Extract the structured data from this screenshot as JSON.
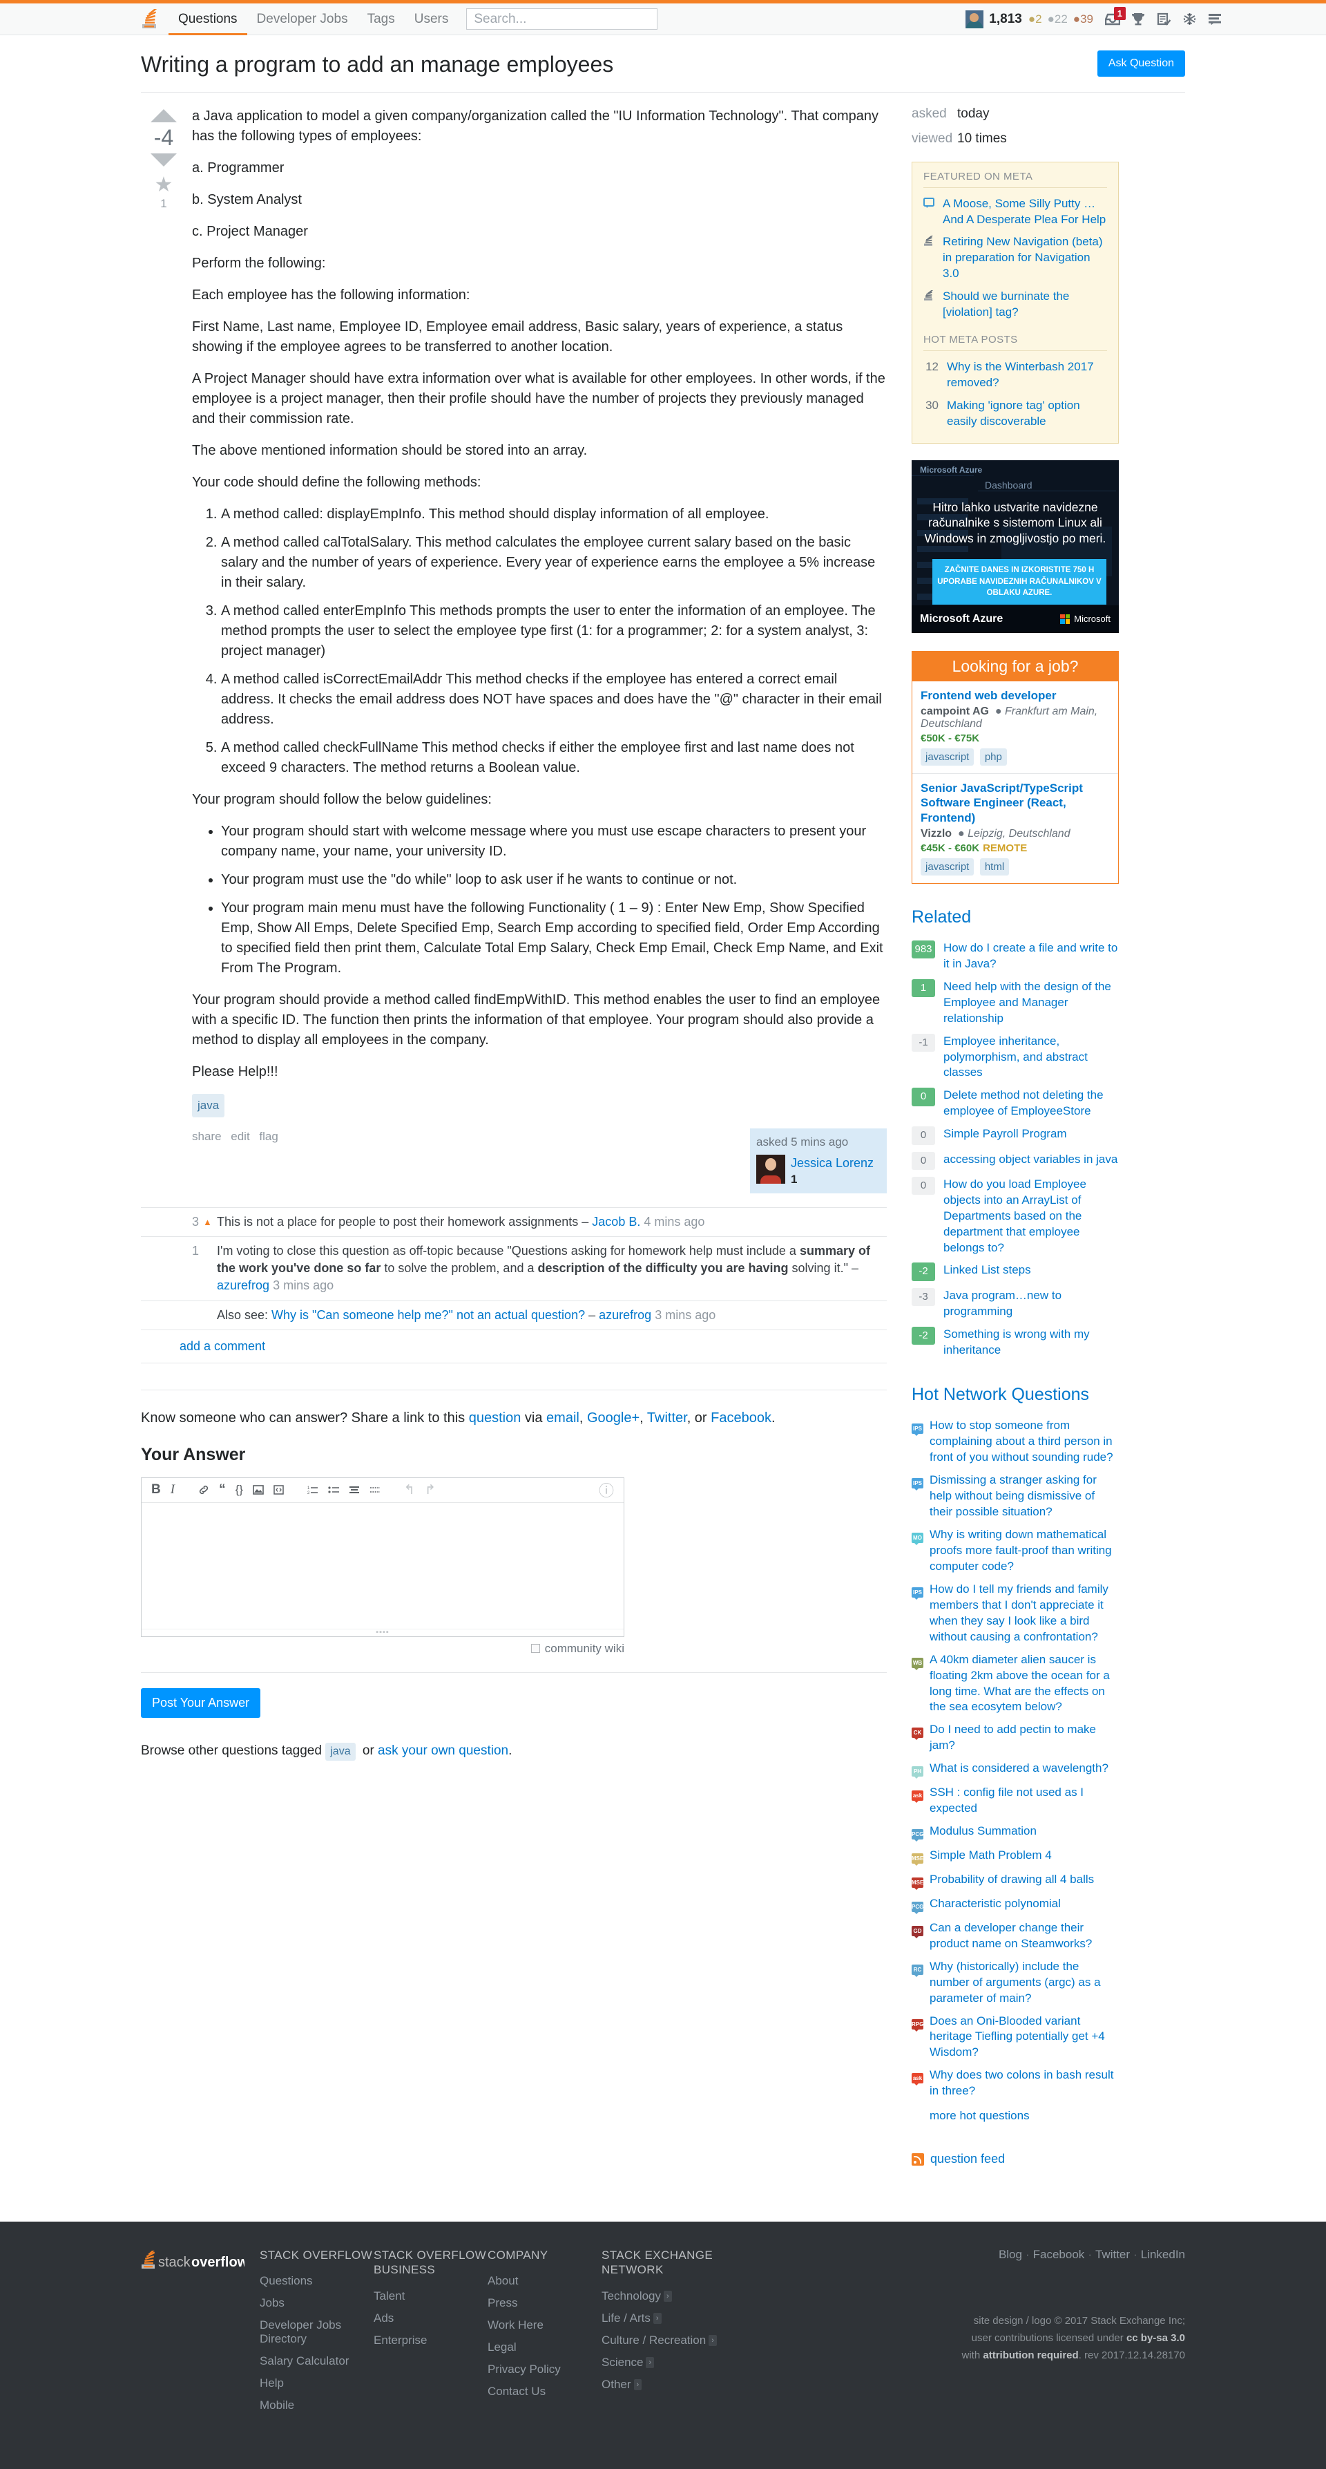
{
  "topnav": {
    "logo_icon": "stackoverflow-logo-icon",
    "items": [
      {
        "label": "Questions",
        "active": true
      },
      {
        "label": "Developer Jobs",
        "active": false
      },
      {
        "label": "Tags",
        "active": false
      },
      {
        "label": "Users",
        "active": false
      }
    ],
    "search_placeholder": "Search...",
    "user": {
      "reputation": "1,813",
      "gold": "2",
      "silver": "22",
      "bronze": "39"
    },
    "icons": [
      {
        "name": "inbox-icon",
        "badge": "1"
      },
      {
        "name": "trophy-icon",
        "badge": ""
      },
      {
        "name": "review-queue-icon",
        "badge": ""
      },
      {
        "name": "snowflake-icon",
        "badge": ""
      },
      {
        "name": "chat-icon",
        "badge": ""
      }
    ]
  },
  "question": {
    "title": "Writing a program to add an manage employees",
    "ask_button": "Ask Question",
    "votes": "-4",
    "favorites": "1",
    "body": {
      "intro1": "a Java application to model a given company/organization called the \"IU Information Technology\". That company has the following types of employees:",
      "type_a": "a. Programmer",
      "type_b": "b. System Analyst",
      "type_c": "c. Project Manager",
      "perform": "Perform the following:",
      "each_emp": "Each employee has the following information:",
      "fields": "First Name, Last name, Employee ID, Employee email address, Basic salary, years of experience, a status showing if the employee agrees to be transferred to another location.",
      "pm_extra": "A Project Manager should have extra information over what is available for other employees. In other words, if the employee is a project manager, then their profile should have the number of projects they previously managed and their commission rate.",
      "array_note": "The above mentioned information should be stored into an array.",
      "methods_intro": "Your code should define the following methods:",
      "methods": [
        "A method called: displayEmpInfo. This method should display information of all employee.",
        "A method called calTotalSalary. This method calculates the employee current salary based on the basic salary and the number of years of experience. Every year of experience earns the employee a 5% increase in their salary.",
        "A method called enterEmpInfo This methods prompts the user to enter the information of an employee. The method prompts the user to select the employee type first (1: for a programmer; 2: for a system analyst, 3: project manager)",
        "A method called isCorrectEmailAddr This method checks if the employee has entered a correct email address. It checks the email address does NOT have spaces and does have the \"@\" character in their email address.",
        "A method called checkFullName This method checks if either the employee first and last name does not exceed 9 characters. The method returns a Boolean value."
      ],
      "guidelines_intro": "Your program should follow the below guidelines:",
      "guidelines": [
        "Your program should start with welcome message where you must use escape characters to present your company name, your name, your university ID.",
        "Your program must use the \"do while\" loop to ask user if he wants to continue or not.",
        "Your program main menu must have the following Functionality ( 1 – 9) : Enter New Emp, Show Specified Emp, Show All Emps, Delete Specified Emp, Search Emp according to specified field, Order Emp According to specified field then print them, Calculate Total Emp Salary, Check Emp Email, Check Emp Name, and Exit From The Program."
      ],
      "find_emp": "Your program should provide a method called findEmpWithID. This method enables the user to find an employee with a specific ID. The function then prints the information of that employee. Your program should also provide a method to display all employees in the company.",
      "please_help": "Please Help!!!"
    },
    "tags": [
      "java"
    ],
    "post_menu": [
      "share",
      "edit",
      "flag"
    ],
    "owner_card": {
      "when": "asked 5 mins ago",
      "name": "Jessica Lorenz",
      "reputation": "1"
    }
  },
  "comments": [
    {
      "score": "3",
      "flagged": true,
      "text": "This is not a place for people to post their homework assignments",
      "user": "Jacob B.",
      "time": "4 mins ago"
    },
    {
      "score": "1",
      "flagged": false,
      "text_pre": "I'm voting to close this question as off-topic because \"Questions asking for homework help must include a ",
      "text_b1": "summary of the work you've done so far",
      "text_mid": " to solve the problem, and a ",
      "text_b2": "description of the difficulty you are having",
      "text_post": " solving it.\"",
      "user": "azurefrog",
      "time": "3 mins ago"
    },
    {
      "score": "",
      "flagged": false,
      "prefix": "Also see: ",
      "link": "Why is \"Can someone help me?\" not an actual question?",
      "user": "azurefrog",
      "time": "3 mins ago"
    }
  ],
  "add_comment": "add a comment",
  "share_notice": {
    "lead": "Know someone who can answer? Share a link to this ",
    "question_link": "question",
    "via": " via ",
    "email": "email",
    "googleplus": "Google+",
    "twitter": "Twitter",
    "or": ", or ",
    "facebook": "Facebook",
    "period": "."
  },
  "answer": {
    "heading": "Your Answer",
    "toolbar": [
      {
        "name": "bold-icon",
        "glyph": "B"
      },
      {
        "name": "italic-icon",
        "glyph": "I"
      },
      {
        "name": "link-icon",
        "glyph": "🔗"
      },
      {
        "name": "blockquote-icon",
        "glyph": "❝"
      },
      {
        "name": "code-icon",
        "glyph": "{}"
      },
      {
        "name": "image-icon",
        "glyph": "🖼"
      },
      {
        "name": "code-block-icon",
        "glyph": "<>"
      },
      {
        "name": "numbered-list-icon",
        "glyph": "1."
      },
      {
        "name": "bulleted-list-icon",
        "glyph": "•"
      },
      {
        "name": "heading-icon",
        "glyph": "≡"
      },
      {
        "name": "horizontal-rule-icon",
        "glyph": "—"
      },
      {
        "name": "undo-icon",
        "glyph": "↶"
      },
      {
        "name": "redo-icon",
        "glyph": "↷"
      }
    ],
    "help_icon": "help-icon",
    "textarea_value": "",
    "community_wiki": "community wiki",
    "post_button": "Post Your Answer"
  },
  "browse": {
    "lead": "Browse other questions tagged ",
    "tag": "java",
    "mid": " or ",
    "ask_own": "ask your own question",
    "period": "."
  },
  "sidebar": {
    "stats": [
      {
        "label": "asked",
        "value": "today"
      },
      {
        "label": "viewed",
        "value": "10 times"
      }
    ],
    "featured_head": "FEATURED ON META",
    "featured": [
      {
        "icon": "speech-bubble-icon",
        "title": "A Moose, Some Silly Putty … And A Desperate Plea For Help"
      },
      {
        "icon": "stackoverflow-mini-icon",
        "title": "Retiring New Navigation (beta) in preparation for Navigation 3.0"
      },
      {
        "icon": "stackoverflow-mini-icon",
        "title": "Should we burninate the [violation] tag?"
      }
    ],
    "hot_meta_head": "HOT META POSTS",
    "hot_meta": [
      {
        "score": "12",
        "title": "Why is the Winterbash 2017 removed?"
      },
      {
        "score": "30",
        "title": "Making 'ignore tag' option easily discoverable"
      }
    ],
    "ad": {
      "product": "Microsoft Azure",
      "dashboard": "Dashboard",
      "headline": "Hitro lahko ustvarite navidezne računalnike s sistemom Linux ali Windows in zmogljivostjo po meri.",
      "cta": "ZAČNITE DANES IN IZKORISTITE 750 H UPORABE NAVIDEZNIH RAČUNALNIKOV V OBLAKU AZURE.",
      "brand": "Microsoft Azure",
      "vendor": "Microsoft"
    },
    "jobs_head": "Looking for a job?",
    "jobs": [
      {
        "title": "Frontend web developer",
        "company": "campoint AG",
        "location": "Frankfurt am Main, Deutschland",
        "salary": "€50K - €75K",
        "remote": "",
        "tags": [
          "javascript",
          "php"
        ]
      },
      {
        "title": "Senior JavaScript/TypeScript Software Engineer (React, Frontend)",
        "company": "Vizzlo",
        "location": "Leipzig, Deutschland",
        "salary": "€45K - €60K",
        "remote": "REMOTE",
        "tags": [
          "javascript",
          "html"
        ]
      }
    ],
    "related_head": "Related",
    "related": [
      {
        "score": "983",
        "green": true,
        "title": "How do I create a file and write to it in Java?"
      },
      {
        "score": "1",
        "green": true,
        "title": "Need help with the design of the Employee and Manager relationship"
      },
      {
        "score": "-1",
        "green": false,
        "title": "Employee inheritance, polymorphism, and abstract classes"
      },
      {
        "score": "0",
        "green": true,
        "title": "Delete method not deleting the employee of EmployeeStore"
      },
      {
        "score": "0",
        "green": false,
        "title": "Simple Payroll Program"
      },
      {
        "score": "0",
        "green": false,
        "title": "accessing object variables in java"
      },
      {
        "score": "0",
        "green": false,
        "title": "How do you load Employee objects into an ArrayList of Departments based on the department that employee belongs to?"
      },
      {
        "score": "-2",
        "green": true,
        "title": "Linked List steps"
      },
      {
        "score": "-3",
        "green": false,
        "title": "Java program…new to programming"
      },
      {
        "score": "-2",
        "green": true,
        "title": "Something is wrong with my inheritance"
      }
    ],
    "hot_head": "Hot Network Questions",
    "hot": [
      {
        "site": "IPS",
        "color": "#4aa3df",
        "title": "How to stop someone from complaining about a third person in front of you without sounding rude?"
      },
      {
        "site": "IPS",
        "color": "#4aa3df",
        "title": "Dismissing a stranger asking for help without being dismissive of their possible situation?"
      },
      {
        "site": "MO",
        "color": "#5bc8d8",
        "title": "Why is writing down mathematical proofs more fault-proof than writing computer code?"
      },
      {
        "site": "IPS",
        "color": "#4aa3df",
        "title": "How do I tell my friends and family members that I don't appreciate it when they say I look like a bird without causing a confrontation?"
      },
      {
        "site": "WB",
        "color": "#8b9d57",
        "title": "A 40km diameter alien saucer is floating 2km above the ocean for a long time. What are the effects on the sea ecosytem below?"
      },
      {
        "site": "CK",
        "color": "#c0392b",
        "title": "Do I need to add pectin to make jam?"
      },
      {
        "site": "PH",
        "color": "#9fd8d2",
        "title": "What is considered a wavelength?"
      },
      {
        "site": "ask",
        "color": "#e8462c",
        "title": "SSH : config file not used as I expected"
      },
      {
        "site": "PCG",
        "color": "#5ba4cf",
        "title": "Modulus Summation"
      },
      {
        "site": "MSE",
        "color": "#d4b96a",
        "title": "Simple Math Problem 4"
      },
      {
        "site": "MSE",
        "color": "#c0392b",
        "title": "Probability of drawing all 4 balls"
      },
      {
        "site": "PCG",
        "color": "#5ba4cf",
        "title": "Characteristic polynomial"
      },
      {
        "site": "GD",
        "color": "#9b3030",
        "title": "Can a developer change their product name on Steamworks?"
      },
      {
        "site": "RC",
        "color": "#5ba4cf",
        "title": "Why (historically) include the number of arguments (argc) as a parameter of main?"
      },
      {
        "site": "RPG",
        "color": "#c0392b",
        "title": "Does an Oni-Blooded variant heritage Tiefling potentially get +4 Wisdom?"
      },
      {
        "site": "ask",
        "color": "#e8462c",
        "title": "Why does two colons in bash result in three?"
      }
    ],
    "more_hot": "more hot questions",
    "feed": "question feed"
  },
  "footer": {
    "logo": "stackoverflow-footer-logo-icon",
    "columns": [
      {
        "heading": "STACK OVERFLOW",
        "links": [
          "Questions",
          "Jobs",
          "Developer Jobs Directory",
          "Salary Calculator",
          "Help",
          "Mobile"
        ]
      },
      {
        "heading": "STACK OVERFLOW BUSINESS",
        "links": [
          "Talent",
          "Ads",
          "Enterprise"
        ]
      },
      {
        "heading": "COMPANY",
        "links": [
          "About",
          "Press",
          "Work Here",
          "Legal",
          "Privacy Policy",
          "Contact Us"
        ]
      }
    ],
    "network_heading": "STACK EXCHANGE NETWORK",
    "network_links": [
      "Technology",
      "Life / Arts",
      "Culture / Recreation",
      "Science",
      "Other"
    ],
    "social": [
      "Blog",
      "Facebook",
      "Twitter",
      "LinkedIn"
    ],
    "legal_line1": "site design / logo © 2017 Stack Exchange Inc;",
    "legal_line2_pre": "user contributions licensed under ",
    "legal_line2_b": "cc by-sa 3.0",
    "legal_line3_pre": "with ",
    "legal_line3_b": "attribution required",
    "legal_line3_post": ". rev 2017.12.14.28170"
  }
}
